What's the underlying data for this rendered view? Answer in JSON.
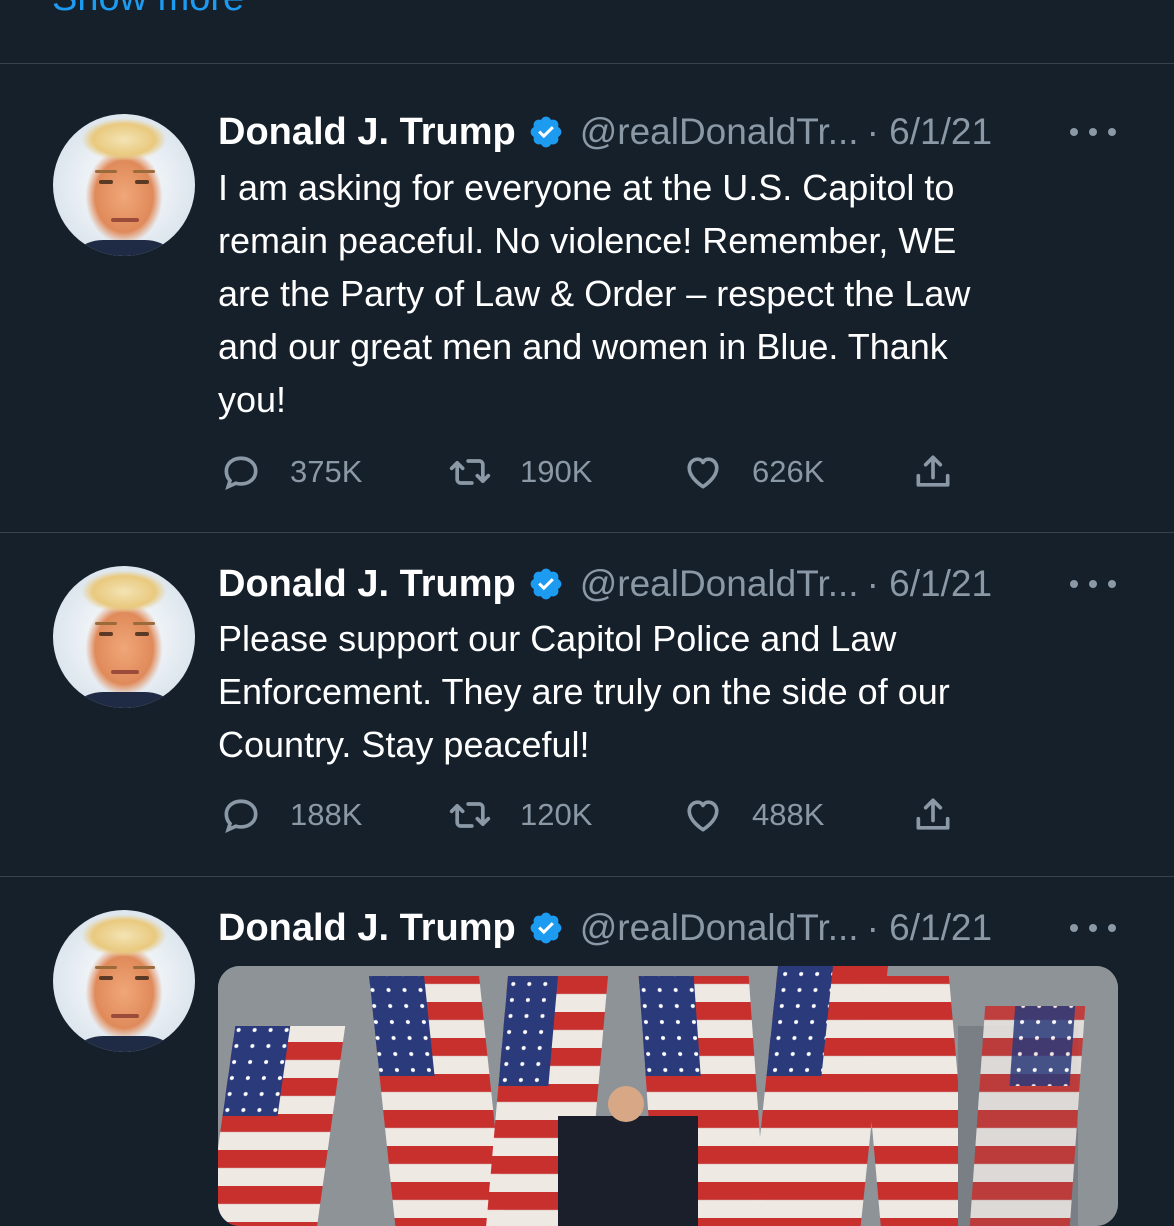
{
  "top": {
    "show_more_label": "Show more"
  },
  "colors": {
    "background": "#15202b",
    "divider": "#38444d",
    "accent": "#1d9bf0",
    "secondary_text": "#8b98a5",
    "primary_text": "#ffffff"
  },
  "tweets": [
    {
      "author": "Donald J. Trump",
      "handle": "@realDonaldTr...",
      "date": "· 6/1/21",
      "verified": true,
      "text": "I am asking for everyone at the U.S. Capitol to\nremain peaceful. No violence! Remember, WE\nare the Party of Law & Order – respect the Law\nand our great men and women in Blue. Thank\nyou!",
      "replies": "375K",
      "retweets": "190K",
      "likes": "626K"
    },
    {
      "author": "Donald J. Trump",
      "handle": "@realDonaldTr...",
      "date": "· 6/1/21",
      "verified": true,
      "text": "Please support our Capitol Police and Law\nEnforcement. They are truly on the side of our\nCountry. Stay peaceful!",
      "replies": "188K",
      "retweets": "120K",
      "likes": "488K"
    },
    {
      "author": "Donald J. Trump",
      "handle": "@realDonaldTr...",
      "date": "· 6/1/21",
      "verified": true,
      "media": "video-thumbnail"
    }
  ],
  "icons": {
    "reply": "reply-icon",
    "retweet": "retweet-icon",
    "like": "heart-icon",
    "share": "share-icon",
    "more": "more-options-icon",
    "verified": "verified-badge-icon"
  }
}
